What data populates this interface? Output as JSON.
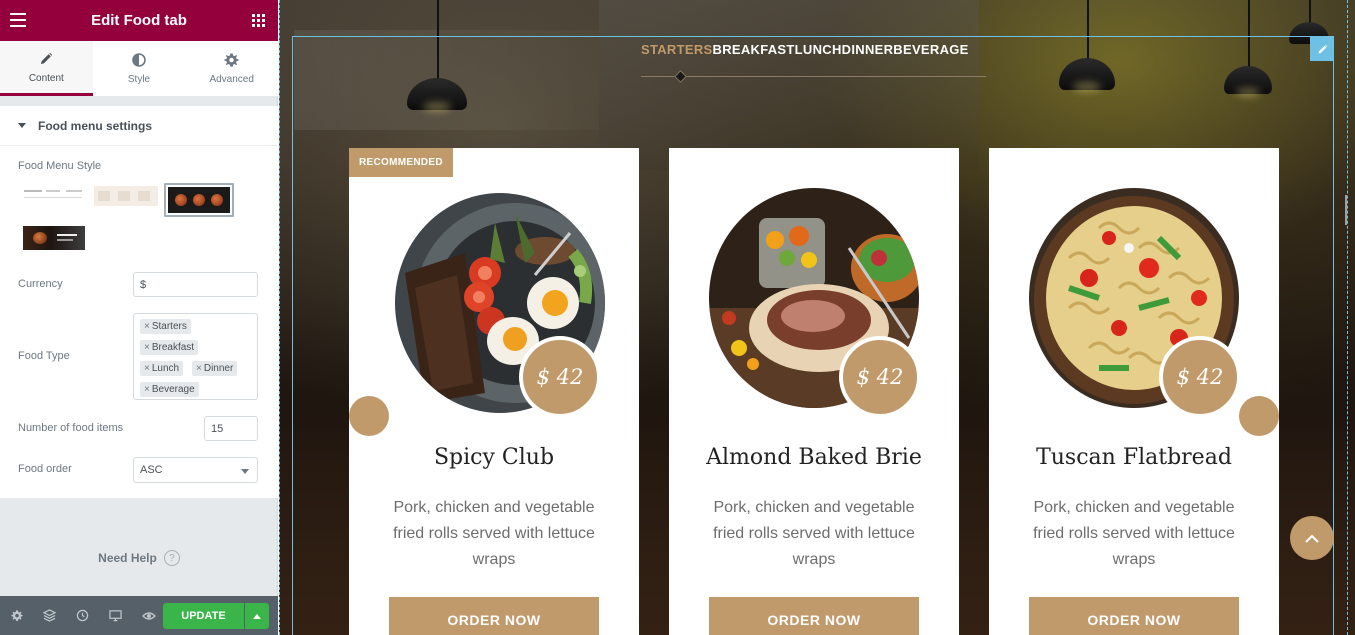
{
  "sidebar": {
    "header": {
      "title": "Edit Food tab",
      "menu_icon": "hamburger-icon",
      "grid_icon": "apps-grid-icon"
    },
    "tabs": [
      {
        "label": "Content",
        "icon": "pencil-icon",
        "active": true
      },
      {
        "label": "Style",
        "icon": "half-circle-icon",
        "active": false
      },
      {
        "label": "Advanced",
        "icon": "gear-icon",
        "active": false
      }
    ],
    "section": {
      "title": "Food menu settings"
    },
    "controls": {
      "style_label": "Food Menu Style",
      "currency_label": "Currency",
      "currency_value": "$",
      "food_type_label": "Food Type",
      "food_types": [
        "Starters",
        "Breakfast",
        "Lunch",
        "Dinner",
        "Beverage"
      ],
      "tag_remove": "×",
      "items_label": "Number of food items",
      "items_value": "15",
      "order_label": "Food order",
      "order_value": "ASC"
    },
    "need_help": "Need Help",
    "help_glyph": "?",
    "footer": {
      "icons": [
        "settings-icon",
        "layers-icon",
        "history-icon",
        "responsive-icon",
        "preview-eye-icon"
      ],
      "update_label": "UPDATE"
    }
  },
  "canvas": {
    "menu_tabs": [
      "STARTERS",
      "BREAKFAST",
      "LUNCH",
      "DINNER",
      "BEVERAGE"
    ],
    "active_tab": "STARTERS",
    "accent": "#c19a6b",
    "cards": [
      {
        "badge": "RECOMMENDED",
        "price": "$ 42",
        "name": "Spicy Club",
        "desc": "Pork, chicken and vegetable fried rolls served with lettuce wraps",
        "button": "ORDER NOW"
      },
      {
        "badge": "",
        "price": "$ 42",
        "name": "Almond Baked Brie",
        "desc": "Pork, chicken and vegetable fried rolls served with lettuce wraps",
        "button": "ORDER NOW"
      },
      {
        "badge": "",
        "price": "$ 42",
        "name": "Tuscan Flatbread",
        "desc": "Pork, chicken and vegetable fried rolls served with lettuce wraps",
        "button": "ORDER NOW"
      }
    ]
  },
  "colors": {
    "brand": "#93003c",
    "update_green": "#39b54a",
    "selection_blue": "#6ec1e4"
  }
}
